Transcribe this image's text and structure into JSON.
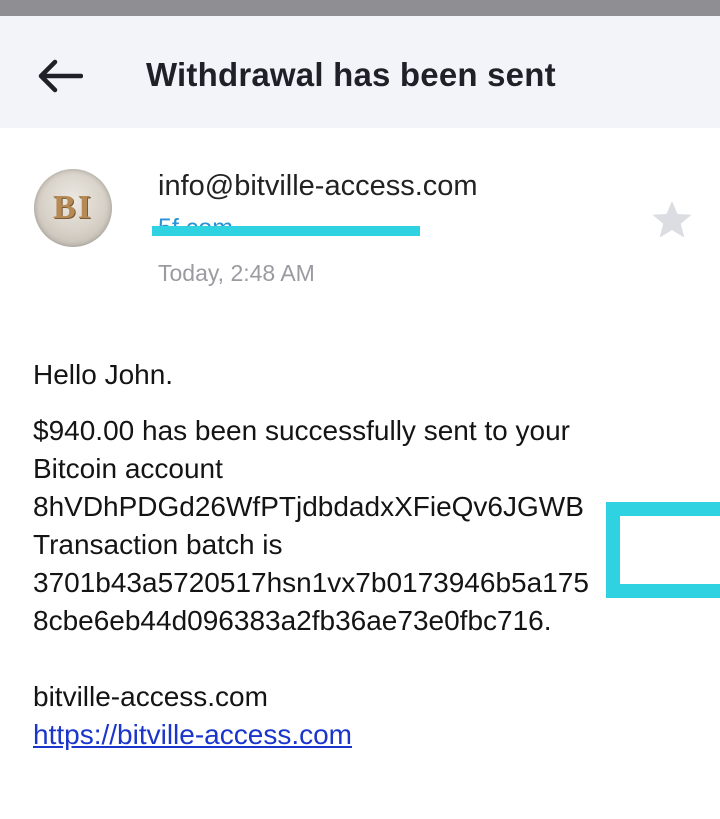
{
  "header": {
    "title": "Withdrawal has been sent"
  },
  "message": {
    "avatar_text": "BI",
    "sender": "info@bitville-access.com",
    "recipient_visible": "5f             com",
    "timestamp": "Today, 2:48 AM"
  },
  "body": {
    "greeting": "Hello John.",
    "line1": "$940.00 has been successfully sent to your",
    "line2": "Bitcoin account",
    "line3": "8hVDhPDGd26WfPTjdbdadxXFieQv6JGWB",
    "line4": "Transaction batch is",
    "line5": "3701b43a5720517hsn1vx7b0173946b5a175",
    "line6": "8cbe6eb44d096383a2fb36ae73e0fbc716.",
    "signature": "bitville-access.com",
    "link": "https://bitville-access.com"
  },
  "colors": {
    "header_bg": "#f3f4f9",
    "accent_link": "#1a35cc",
    "recipient": "#2a92d6",
    "redaction": "#2fd2e0",
    "star": "#dcdde3"
  },
  "icons": {
    "back": "arrow-left-icon",
    "star": "star-icon"
  }
}
